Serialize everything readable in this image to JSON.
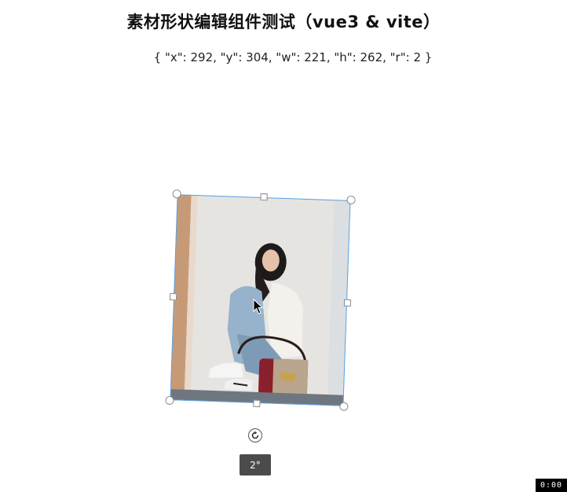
{
  "page": {
    "title": "素材形状编辑组件测试（vue3 & vite）",
    "coords_text": "{ \"x\": 292, \"y\": 304, \"w\": 221, \"h\": 262, \"r\": 2 }"
  },
  "editor": {
    "image_alt": "photo-woman-sitting-with-handbag",
    "rotation_label": "2°",
    "rotation_degrees": 2,
    "rotate_icon": "rotate-clockwise-icon",
    "border_color": "#5aa2e6"
  },
  "recording": {
    "timer": "0:00"
  }
}
